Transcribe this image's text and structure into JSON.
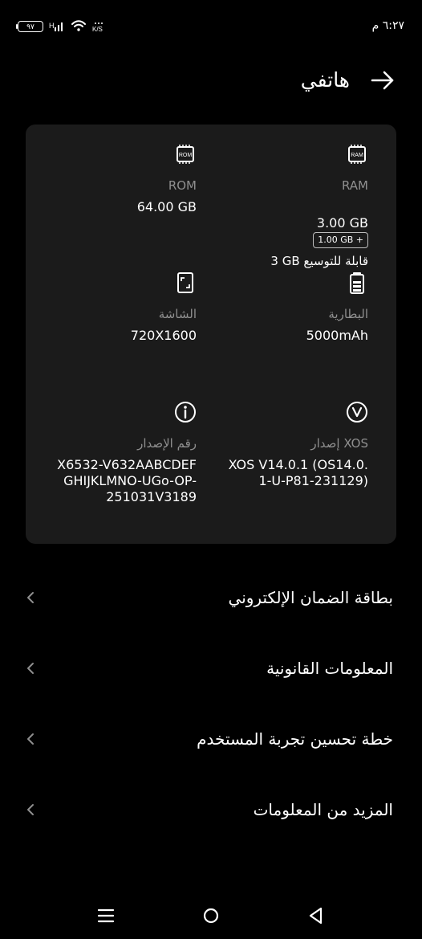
{
  "status": {
    "time": "٦:٢٧ م",
    "battery": "٩٧",
    "signal_label": "H",
    "speed_label": "K/S"
  },
  "header": {
    "title": "هاتفي"
  },
  "specs": {
    "ram": {
      "icon": "ram-chip-icon",
      "label": "RAM",
      "value": "3.00 GB",
      "chip": "1.00 GB +",
      "sub": "3 GB قابلة للتوسيع"
    },
    "rom": {
      "icon": "rom-chip-icon",
      "label": "ROM",
      "value": "64.00 GB"
    },
    "battery": {
      "icon": "battery-icon",
      "label": "البطارية",
      "value": "5000mAh"
    },
    "screen": {
      "icon": "screen-icon",
      "label": "الشاشة",
      "value": "720X1600"
    },
    "xos": {
      "icon": "xos-icon",
      "label": "إصدار XOS",
      "value": "XOS V14.0.1 (OS14.0.\n1-U-P81-231129)"
    },
    "build": {
      "icon": "info-icon",
      "label": "رقم الإصدار",
      "value": "X6532-V632AABCDEF\nGHIJKLMNO-UGo-OP-\n251031V3189"
    }
  },
  "menu": [
    {
      "label": "بطاقة الضمان الإلكتروني"
    },
    {
      "label": "المعلومات القانونية"
    },
    {
      "label": "خطة تحسين تجربة المستخدم"
    },
    {
      "label": "المزيد من المعلومات"
    }
  ]
}
